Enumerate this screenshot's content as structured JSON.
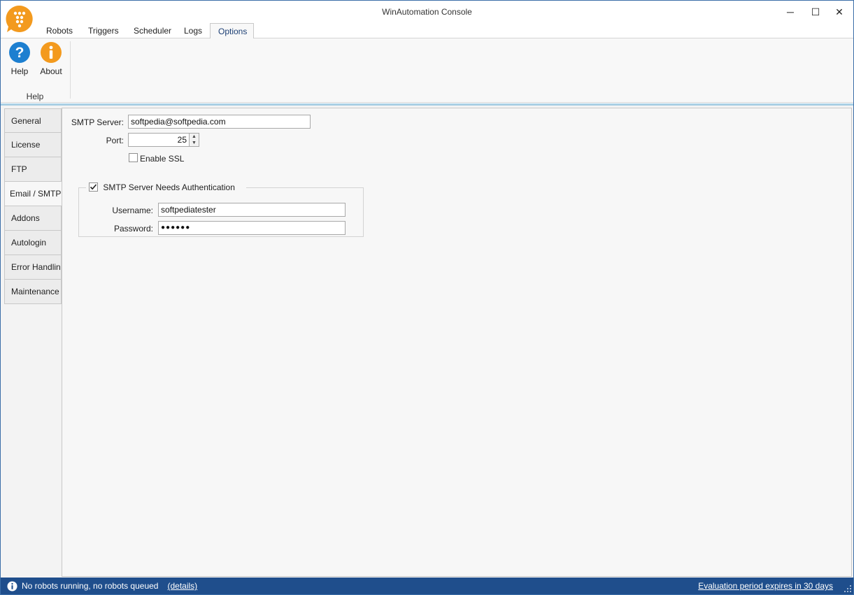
{
  "window": {
    "title": "WinAutomation Console",
    "minimize_glyph": "─",
    "maximize_glyph": "☐",
    "close_glyph": "✕"
  },
  "ribbon": {
    "tabs": [
      "Robots",
      "Triggers",
      "Scheduler",
      "Logs",
      "Options"
    ],
    "active_tab": "Options",
    "buttons": [
      {
        "label": "Help",
        "icon": "help-icon",
        "color": "#1d7fd0"
      },
      {
        "label": "About",
        "icon": "info-icon",
        "color": "#f39a1e"
      }
    ],
    "group_label": "Help"
  },
  "sidebar": {
    "items": [
      "General",
      "License",
      "FTP",
      "Email / SMTP",
      "Addons",
      "Autologin",
      "Error Handling",
      "Maintenance"
    ],
    "active": "Email / SMTP"
  },
  "form": {
    "smtp_server_label": "SMTP Server:",
    "smtp_server_value": "softpedia@softpedia.com",
    "port_label": "Port:",
    "port_value": "25",
    "enable_ssl_label": "Enable SSL",
    "enable_ssl_checked": false,
    "auth_label": "SMTP Server Needs Authentication",
    "auth_checked": true,
    "username_label": "Username:",
    "username_value": "softpediatester",
    "password_label": "Password:",
    "password_value": "●●●●●●"
  },
  "statusbar": {
    "left_text": "No robots running, no robots queued",
    "details_link": "(details)",
    "right_text": "Evaluation period expires in 30 days"
  },
  "colors": {
    "accent": "#1f4e8c",
    "logo": "#f39a1e"
  }
}
